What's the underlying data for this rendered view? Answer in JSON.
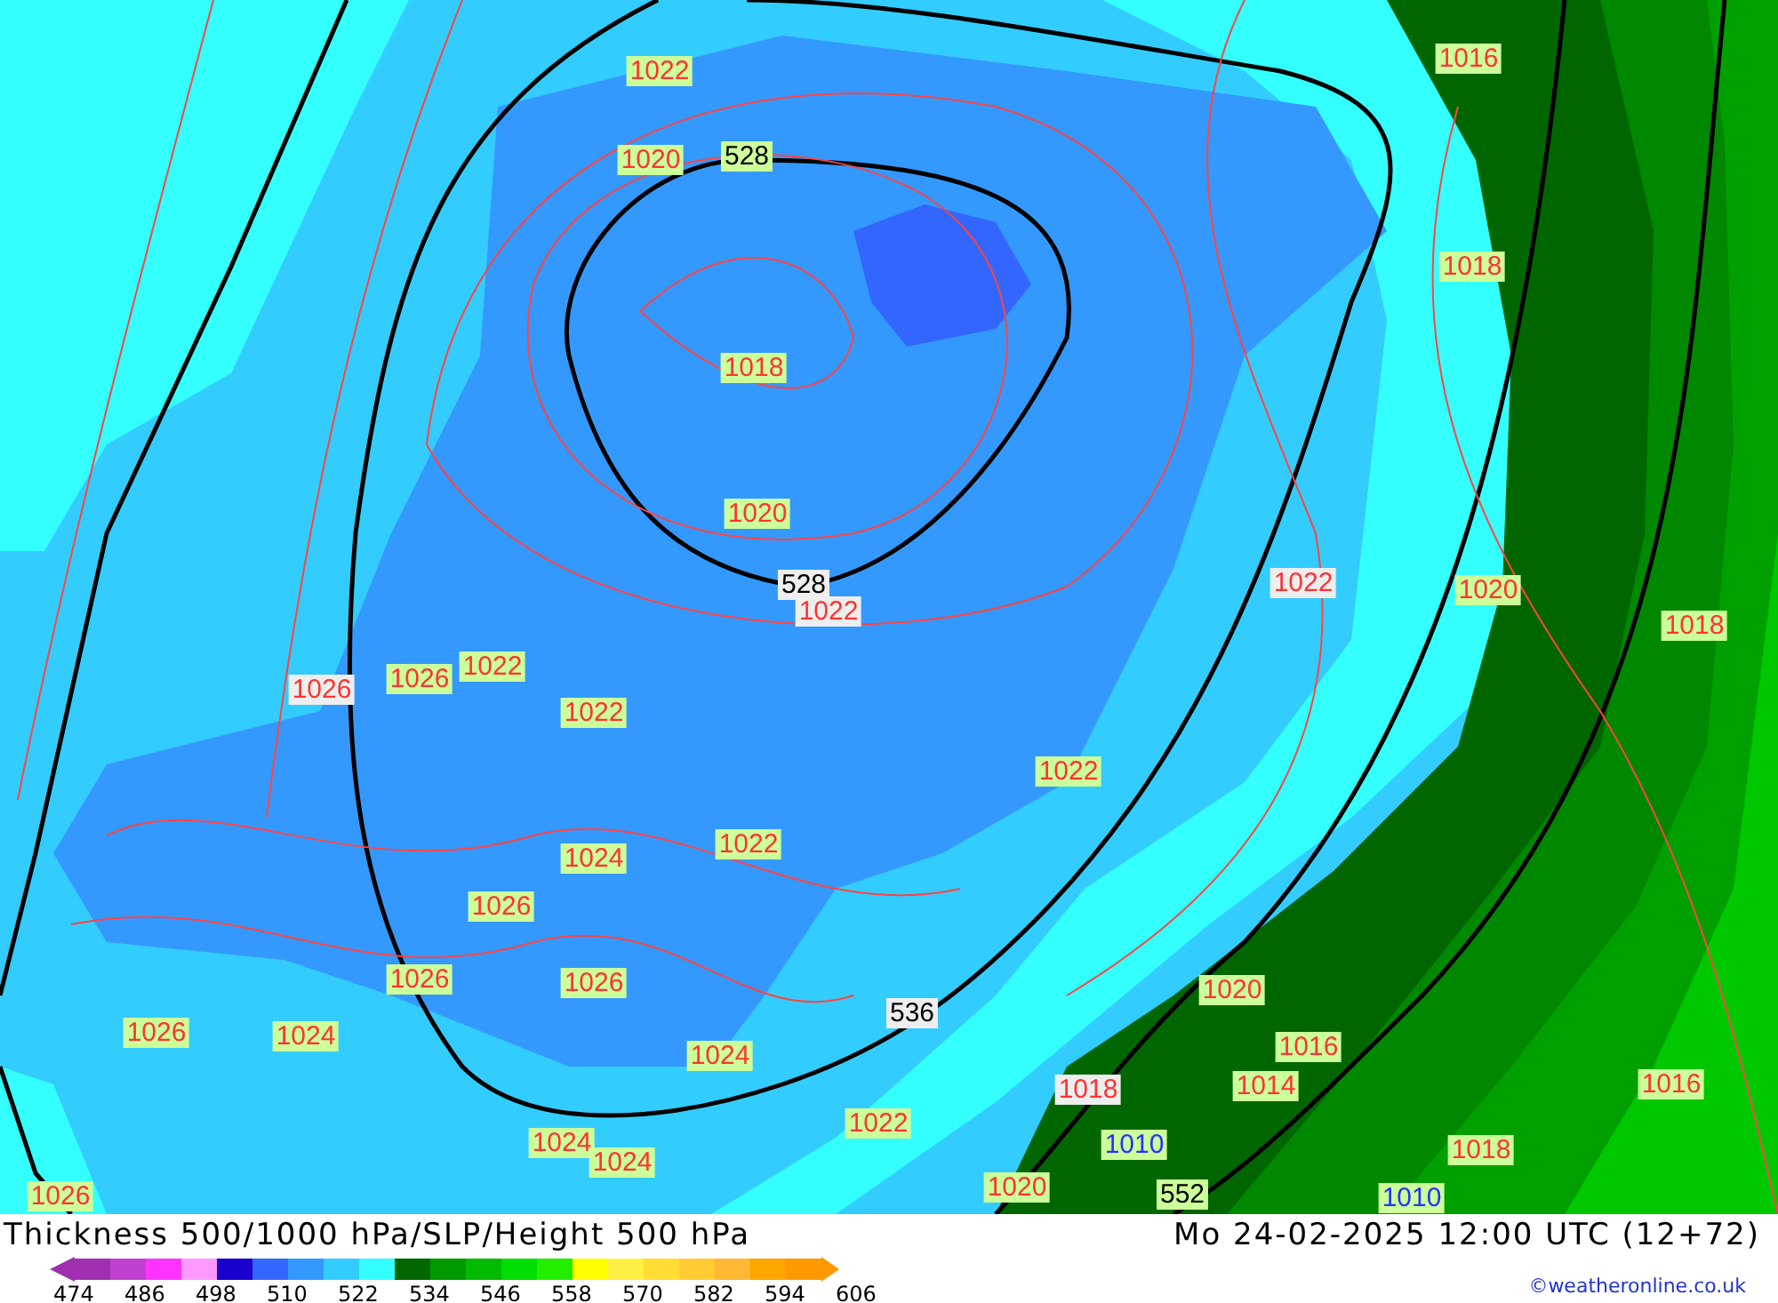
{
  "map": {
    "labels": [
      {
        "text": "1022",
        "kind": "isobar",
        "color": "#ccff99"
      },
      {
        "text": "1020",
        "kind": "isobar",
        "color": "#ccff99"
      },
      {
        "text": "528",
        "kind": "thickness",
        "color": "#ccff99"
      },
      {
        "text": "1018",
        "kind": "isobar",
        "color": "#ccff99"
      },
      {
        "text": "1020",
        "kind": "isobar",
        "color": "#ccff99"
      },
      {
        "text": "528",
        "kind": "thickness",
        "color": "#eeeeee"
      },
      {
        "text": "1022",
        "kind": "isobar",
        "color": "#eeeeee"
      },
      {
        "text": "1016",
        "kind": "isobar",
        "color": "#ccff99"
      },
      {
        "text": "1018",
        "kind": "isobar",
        "color": "#ccff99"
      },
      {
        "text": "1022",
        "kind": "isobar",
        "color": "#eeeeee"
      },
      {
        "text": "1020",
        "kind": "isobar",
        "color": "#ccff99"
      },
      {
        "text": "1018",
        "kind": "isobar",
        "color": "#ccff99"
      },
      {
        "text": "1026",
        "kind": "isobar",
        "color": "#eeeeee"
      },
      {
        "text": "1026",
        "kind": "isobar",
        "color": "#ccff99"
      },
      {
        "text": "1022",
        "kind": "isobar",
        "color": "#ccff99"
      },
      {
        "text": "1022",
        "kind": "isobar",
        "color": "#ccff99"
      },
      {
        "text": "1022",
        "kind": "isobar",
        "color": "#ccff99"
      },
      {
        "text": "1022",
        "kind": "isobar",
        "color": "#ccff99"
      },
      {
        "text": "1024",
        "kind": "isobar",
        "color": "#ccff99"
      },
      {
        "text": "1026",
        "kind": "isobar",
        "color": "#ccff99"
      },
      {
        "text": "1026",
        "kind": "isobar",
        "color": "#ccff99"
      },
      {
        "text": "1026",
        "kind": "isobar",
        "color": "#ccff99"
      },
      {
        "text": "536",
        "kind": "thickness",
        "color": "#eeeeee"
      },
      {
        "text": "1020",
        "kind": "isobar",
        "color": "#ccff99"
      },
      {
        "text": "1026",
        "kind": "isobar",
        "color": "#ccff99"
      },
      {
        "text": "1024",
        "kind": "isobar",
        "color": "#ccff99"
      },
      {
        "text": "1016",
        "kind": "isobar",
        "color": "#ccff99"
      },
      {
        "text": "1024",
        "kind": "isobar",
        "color": "#ccff99"
      },
      {
        "text": "1018",
        "kind": "isobar",
        "color": "#eeeeee"
      },
      {
        "text": "1014",
        "kind": "isobar",
        "color": "#ccff99"
      },
      {
        "text": "1016",
        "kind": "isobar",
        "color": "#ccff99"
      },
      {
        "text": "1022",
        "kind": "isobar",
        "color": "#ccff99"
      },
      {
        "text": "1024",
        "kind": "isobar",
        "color": "#ccff99"
      },
      {
        "text": "1010",
        "kind": "low-isobar",
        "color": "#ccff99"
      },
      {
        "text": "1018",
        "kind": "isobar",
        "color": "#ccff99"
      },
      {
        "text": "1024",
        "kind": "isobar",
        "color": "#ccff99"
      },
      {
        "text": "1026",
        "kind": "isobar",
        "color": "#ccff99"
      },
      {
        "text": "1020",
        "kind": "isobar",
        "color": "#ccff99"
      },
      {
        "text": "552",
        "kind": "thickness",
        "color": "#ccff99"
      },
      {
        "text": "1010",
        "kind": "low-isobar",
        "color": "#ccff99"
      }
    ]
  },
  "title": "Thickness 500/1000 hPa/SLP/Height 500 hPa",
  "valid_time": "Mo 24-02-2025 12:00 UTC (12+72)",
  "colorbar": {
    "segments": [
      {
        "color": "#a030b0"
      },
      {
        "color": "#c040d0"
      },
      {
        "color": "#ff33ff"
      },
      {
        "color": "#ff99ff"
      },
      {
        "color": "#1a00cc"
      },
      {
        "color": "#3366ff"
      },
      {
        "color": "#3399ff"
      },
      {
        "color": "#33ccff"
      },
      {
        "color": "#33ffff"
      },
      {
        "color": "#006600"
      },
      {
        "color": "#009900"
      },
      {
        "color": "#00bb00"
      },
      {
        "color": "#00dd00"
      },
      {
        "color": "#22ee00"
      },
      {
        "color": "#ffff00"
      },
      {
        "color": "#ffee44"
      },
      {
        "color": "#ffdd33"
      },
      {
        "color": "#ffcc33"
      },
      {
        "color": "#ffb833"
      },
      {
        "color": "#ffa500"
      },
      {
        "color": "#ff9900"
      }
    ],
    "labels": [
      "474",
      "486",
      "498",
      "510",
      "522",
      "534",
      "546",
      "558",
      "570",
      "582",
      "594",
      "606"
    ]
  },
  "credit": "©weatheronline.co.uk"
}
